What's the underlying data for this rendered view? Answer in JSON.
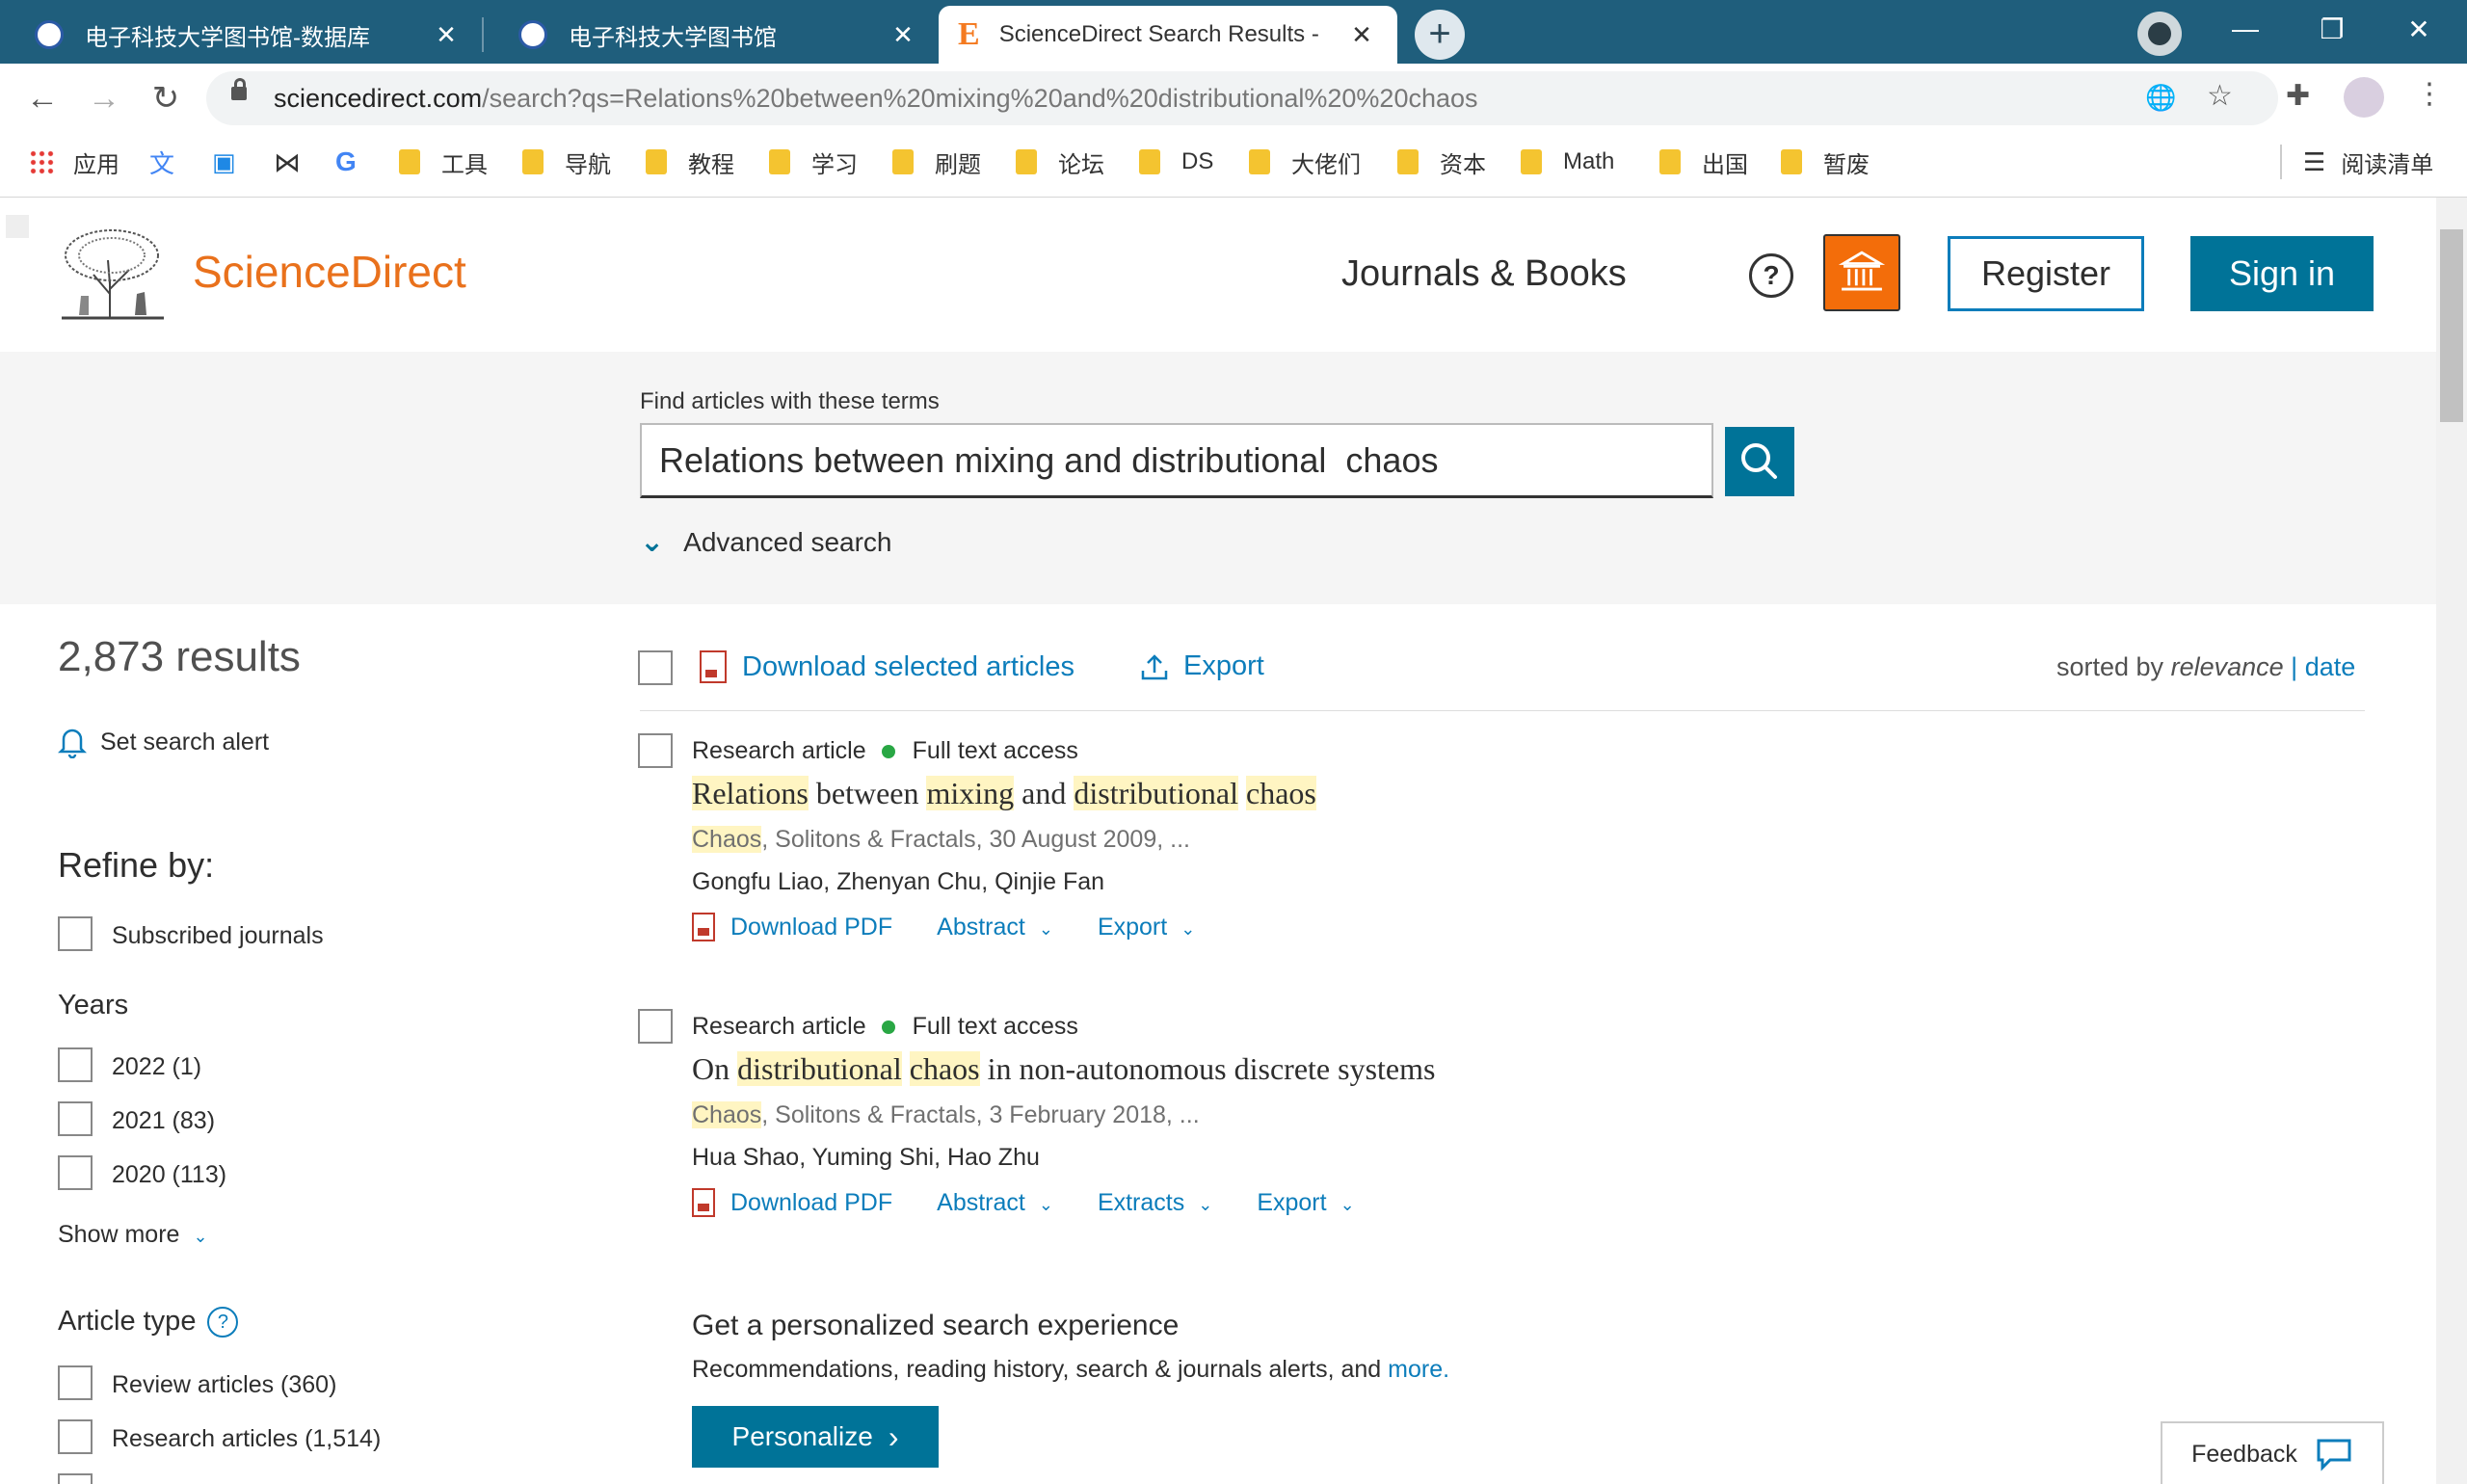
{
  "browser": {
    "tabs": [
      {
        "title": "电子科技大学图书馆-数据库",
        "active": false
      },
      {
        "title": "电子科技大学图书馆",
        "active": false
      },
      {
        "title": "ScienceDirect Search Results -",
        "active": true
      }
    ],
    "url_host": "sciencedirect.com",
    "url_path": "/search?qs=Relations%20between%20mixing%20and%20distributional%20%20chaos",
    "bookmarks": [
      "应用",
      "工具",
      "导航",
      "教程",
      "学习",
      "刷题",
      "论坛",
      "DS",
      "大佬们",
      "资本",
      "Math",
      "出国",
      "暂废"
    ],
    "reading_list": "阅读清单"
  },
  "header": {
    "brand": "ScienceDirect",
    "journals_books": "Journals & Books",
    "help": "?",
    "register": "Register",
    "sign_in": "Sign in"
  },
  "search": {
    "label": "Find articles with these terms",
    "query": "Relations between mixing and distributional  chaos",
    "advanced": "Advanced search"
  },
  "sidebar": {
    "results_count": "2,873 results",
    "set_alert": "Set search alert",
    "refine_by": "Refine by:",
    "subscribed": "Subscribed journals",
    "years_title": "Years",
    "years": [
      "2022 (1)",
      "2021 (83)",
      "2020 (113)"
    ],
    "show_more": "Show more",
    "article_type_title": "Article type",
    "article_types": [
      "Review articles (360)",
      "Research articles (1,514)"
    ]
  },
  "toolbar": {
    "download_selected": "Download selected articles",
    "export": "Export",
    "sorted_by": "sorted by",
    "relevance": "relevance",
    "sep": "|",
    "date": "date"
  },
  "results": [
    {
      "type": "Research article",
      "access": "Full text access",
      "title_parts": [
        {
          "t": "Relations",
          "hl": true
        },
        {
          "t": " between ",
          "hl": false
        },
        {
          "t": "mixing",
          "hl": true
        },
        {
          "t": " and ",
          "hl": false
        },
        {
          "t": "distributional",
          "hl": true
        },
        {
          "t": " ",
          "hl": false
        },
        {
          "t": "chaos",
          "hl": true
        }
      ],
      "source_hl": "Chaos",
      "source_rest": ", Solitons & Fractals, 30 August 2009, ...",
      "authors": "Gongfu Liao, Zhenyan Chu, Qinjie Fan",
      "actions": [
        "Download PDF",
        "Abstract",
        "Export"
      ]
    },
    {
      "type": "Research article",
      "access": "Full text access",
      "title_parts": [
        {
          "t": "On ",
          "hl": false
        },
        {
          "t": "distributional",
          "hl": true
        },
        {
          "t": " ",
          "hl": false
        },
        {
          "t": "chaos",
          "hl": true
        },
        {
          "t": " in non-autonomous discrete systems",
          "hl": false
        }
      ],
      "source_hl": "Chaos",
      "source_rest": ", Solitons & Fractals, 3 February 2018, ...",
      "authors": "Hua Shao, Yuming Shi, Hao Zhu",
      "actions": [
        "Download PDF",
        "Abstract",
        "Extracts",
        "Export"
      ]
    }
  ],
  "personalize": {
    "heading": "Get a personalized search experience",
    "text": "Recommendations, reading history, search & journals alerts, and",
    "more": "more.",
    "button": "Personalize"
  },
  "feedback": "Feedback",
  "colors": {
    "brand_orange": "#e9711c",
    "accent_blue": "#007398",
    "link_blue": "#0c7dbb",
    "highlight": "#fff5c2",
    "chrome_tabbar": "#1f5e7c"
  }
}
